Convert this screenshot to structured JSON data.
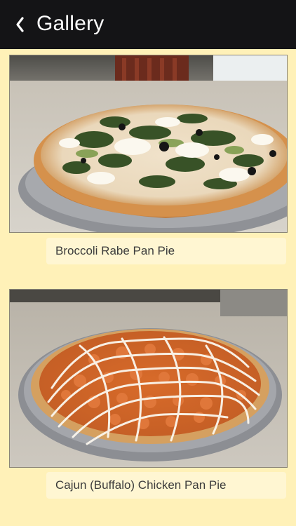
{
  "header": {
    "title": "Gallery",
    "back_icon": "chevron-left-icon"
  },
  "gallery": {
    "items": [
      {
        "label": "Broccoli Rabe Pan Pie"
      },
      {
        "label": "Cajun (Buffalo) Chicken Pan Pie"
      }
    ]
  },
  "colors": {
    "background": "#fff1b8",
    "header": "#141416",
    "caption_bg": "#fff6d2",
    "caption_text": "#3c3c3c"
  }
}
